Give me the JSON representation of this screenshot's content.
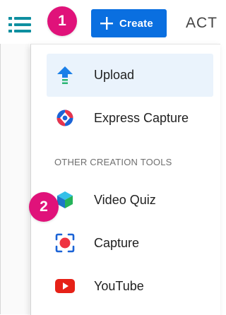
{
  "toolbar": {
    "create_label": "Create",
    "cut_label": "ACT",
    "icons": {
      "menu": "list-icon",
      "create": "plus-icon"
    }
  },
  "badges": {
    "first": "1",
    "second": "2",
    "color": "#e0127a"
  },
  "menu": {
    "items": [
      {
        "label": "Upload",
        "icon": "upload-arrow-icon"
      },
      {
        "label": "Express Capture",
        "icon": "express-capture-icon"
      }
    ],
    "section_label": "OTHER CREATION TOOLS",
    "tools": [
      {
        "label": "Video Quiz",
        "icon": "video-quiz-cube-icon"
      },
      {
        "label": "Capture",
        "icon": "capture-record-icon"
      },
      {
        "label": "YouTube",
        "icon": "youtube-icon"
      }
    ]
  },
  "colors": {
    "accent": "#0a6fe0",
    "hover": "#eaf3fc",
    "badge": "#e0127a"
  }
}
